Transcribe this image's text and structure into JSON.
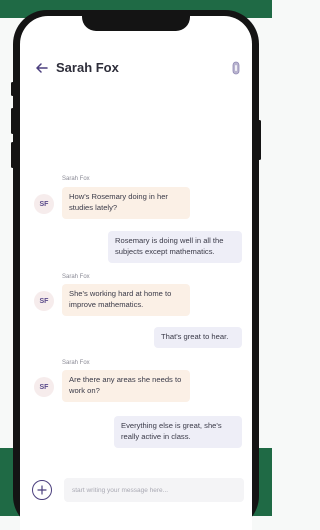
{
  "header": {
    "title": "Sarah Fox"
  },
  "contact": {
    "initials": "SF",
    "name": "Sarah Fox"
  },
  "messages": [
    {
      "from": "contact",
      "sender": "Sarah Fox",
      "text": "How's Rosemary doing in her studies lately?"
    },
    {
      "from": "me",
      "text": "Rosemary is doing well in all the subjects except mathematics."
    },
    {
      "from": "contact",
      "sender": "Sarah Fox",
      "text": "She's working hard at home to improve mathematics."
    },
    {
      "from": "me",
      "text": "That's great to hear."
    },
    {
      "from": "contact",
      "sender": "Sarah Fox",
      "text": "Are there any areas she needs to work on?"
    },
    {
      "from": "me",
      "text": "Everything else is great, she's really active in class."
    }
  ],
  "composer": {
    "placeholder": "start writing your message here..."
  },
  "icons": {
    "back": "arrow-left-icon",
    "attach": "attachment-icon",
    "add": "plus-icon"
  },
  "colors": {
    "accent": "#4b3f7e",
    "brand_green": "#1f6a45",
    "incoming_bubble": "#fbf0e6",
    "outgoing_bubble": "#eeeef7"
  }
}
